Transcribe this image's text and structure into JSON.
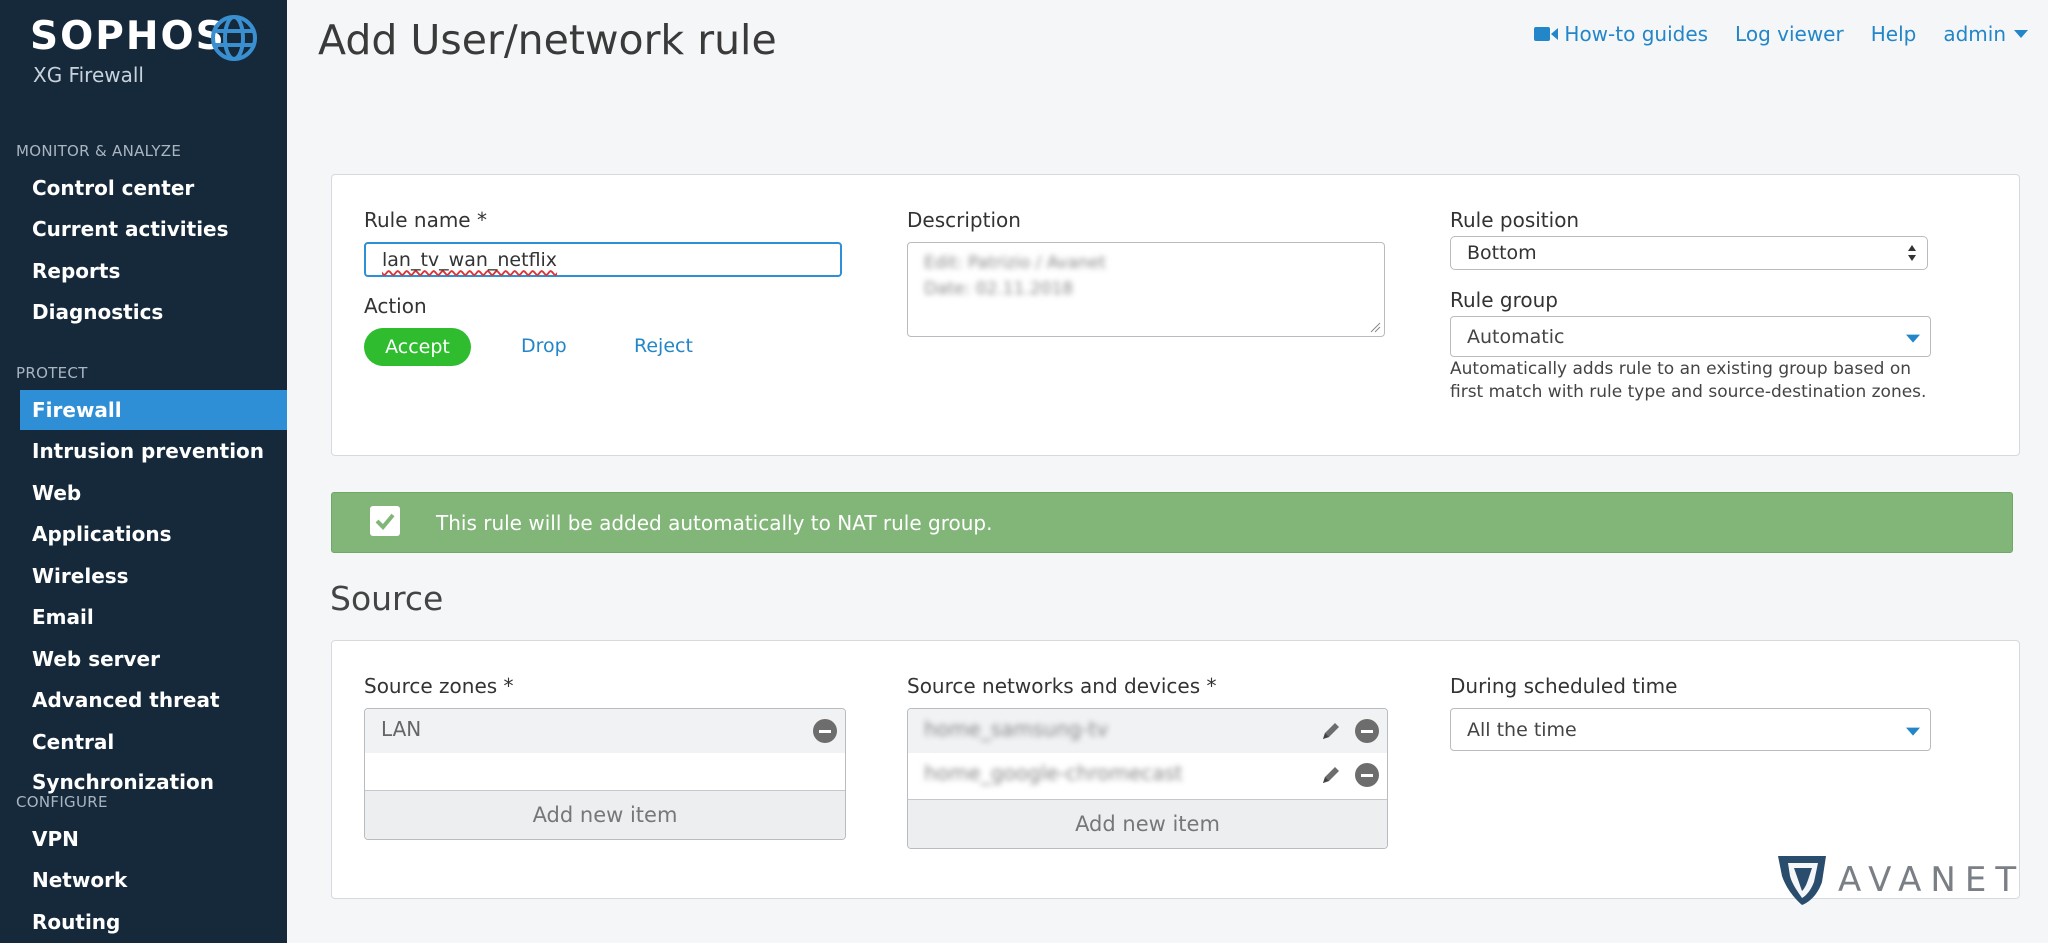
{
  "brand": {
    "name": "SOPHOS",
    "product": "XG Firewall"
  },
  "sidebar": {
    "sections": [
      {
        "title": "MONITOR & ANALYZE",
        "items": [
          "Control center",
          "Current activities",
          "Reports",
          "Diagnostics"
        ]
      },
      {
        "title": "PROTECT",
        "items": [
          "Firewall",
          "Intrusion prevention",
          "Web",
          "Applications",
          "Wireless",
          "Email",
          "Web server",
          "Advanced threat",
          "Central Synchronization"
        ]
      },
      {
        "title": "CONFIGURE",
        "items": [
          "VPN",
          "Network",
          "Routing"
        ]
      }
    ],
    "active_item": "Firewall"
  },
  "header": {
    "title": "Add User/network rule",
    "links": {
      "howto": "How-to guides",
      "logviewer": "Log viewer",
      "help": "Help",
      "admin": "admin"
    }
  },
  "rule": {
    "name_label": "Rule name *",
    "name_value": "lan_tv_wan_netflix",
    "action_label": "Action",
    "actions": {
      "accept": "Accept",
      "drop": "Drop",
      "reject": "Reject"
    },
    "selected_action": "Accept",
    "description_label": "Description",
    "description_lines": [
      "Edit: Patrizio / Avanet",
      "Date: 02.11.2018"
    ],
    "position_label": "Rule position",
    "position_value": "Bottom",
    "group_label": "Rule group",
    "group_value": "Automatic",
    "group_help": "Automatically adds rule to an existing group based on first match with rule type and source-destination zones."
  },
  "notice": {
    "text": "This rule will be added automatically to NAT rule group.",
    "checked": true
  },
  "source": {
    "title": "Source",
    "zones_label": "Source zones *",
    "zones": [
      "LAN"
    ],
    "networks_label": "Source networks and devices *",
    "networks": [
      "home_samsung-tv",
      "home_google-chromecast"
    ],
    "add_new": "Add new item",
    "schedule_label": "During scheduled time",
    "schedule_value": "All the time"
  },
  "watermark": {
    "text": "AVANET"
  },
  "colors": {
    "sidebar": "#16293a",
    "accent": "#2f8fd6",
    "link": "#2386c8",
    "accept": "#2fbd2f",
    "notice": "#82b679"
  }
}
